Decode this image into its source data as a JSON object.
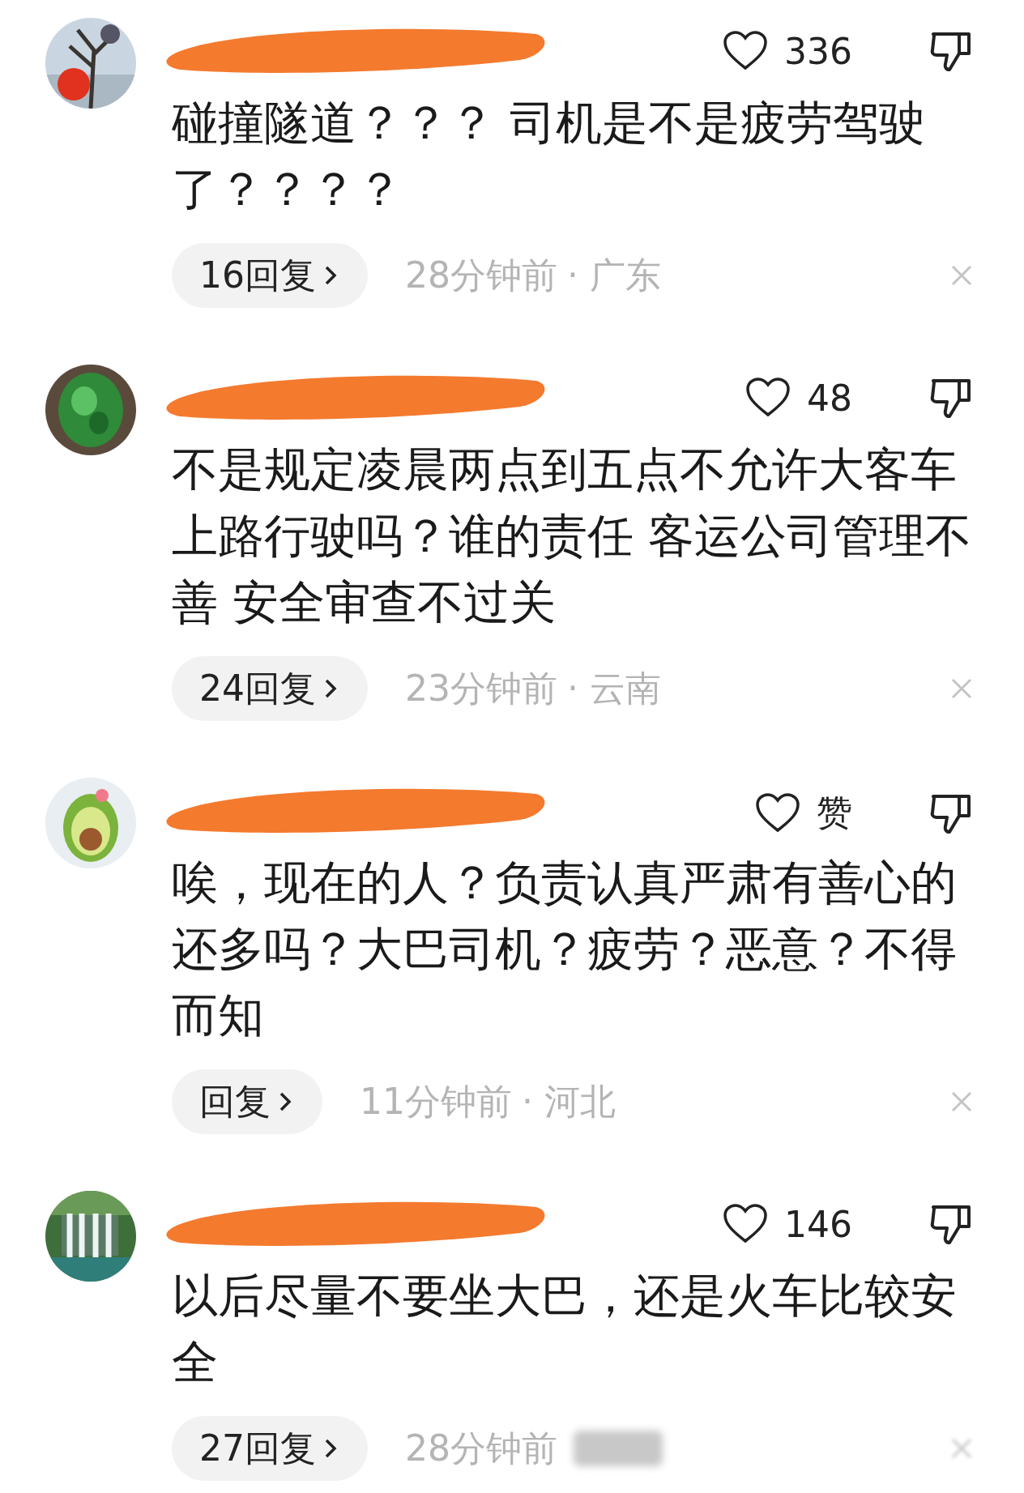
{
  "comments": [
    {
      "like_count": "336",
      "text_lines": [
        "碰撞隧道？？？ 司机是不是疲劳驾驶",
        "了？？？？"
      ],
      "replies": "16回复",
      "time": "28分钟前",
      "location": "· 广东",
      "location_blurred": false
    },
    {
      "like_count": "48",
      "text_lines": [
        "不是规定凌晨两点到五点不允许大客车",
        "上路行驶吗？谁的责任 客运公司管理不",
        "善 安全审查不过关"
      ],
      "replies": "24回复",
      "time": "23分钟前",
      "location": "· 云南",
      "location_blurred": false
    },
    {
      "like_count": "赞",
      "text_lines": [
        "唉，现在的人？负责认真严肃有善心的",
        "还多吗？大巴司机？疲劳？恶意？不得",
        "而知"
      ],
      "replies": "回复",
      "time": "11分钟前",
      "location": "· 河北",
      "location_blurred": false
    },
    {
      "like_count": "146",
      "text_lines": [
        "以后尽量不要坐大巴，还是火车比较安",
        "全"
      ],
      "replies": "27回复",
      "time": "28分钟前",
      "location_blurred": true
    }
  ]
}
